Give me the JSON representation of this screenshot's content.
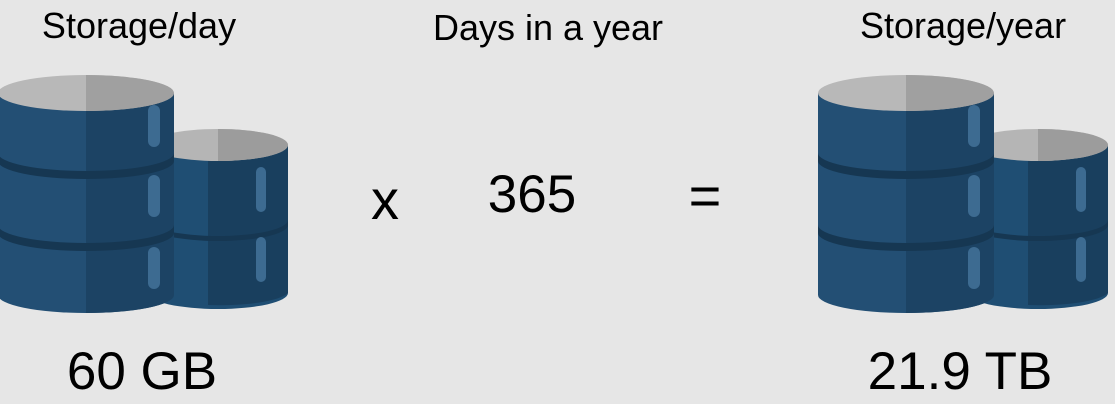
{
  "left": {
    "title": "Storage/day",
    "value": "60 GB"
  },
  "middle": {
    "title": "Days in a year",
    "multiply_symbol": "x",
    "value": "365",
    "equals_symbol": "="
  },
  "right": {
    "title": "Storage/year",
    "value": "21.9 TB"
  },
  "icons": {
    "left": "database-stack-icon",
    "right": "database-stack-icon"
  },
  "colors": {
    "background": "#e6e6e6",
    "db_body": "#1f4e73",
    "db_top": "#b8b8b8"
  }
}
